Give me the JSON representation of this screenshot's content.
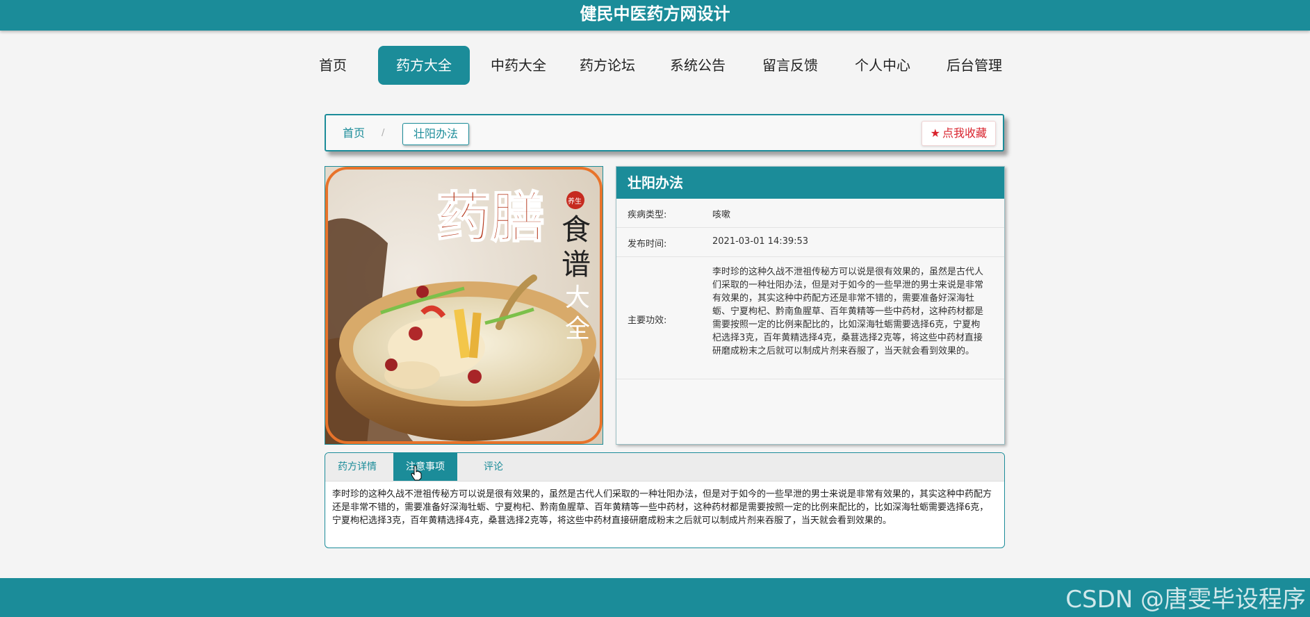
{
  "site": {
    "title": "健民中医药方网设计"
  },
  "nav": {
    "items": [
      "首页",
      "药方大全",
      "中药大全",
      "药方论坛",
      "系统公告",
      "留言反馈",
      "个人中心",
      "后台管理"
    ],
    "active": "药方大全"
  },
  "breadcrumb": {
    "home": "首页",
    "separator": "/",
    "current": "壮阳办法"
  },
  "favorite_button": {
    "icon": "star-icon",
    "label": "点我收藏"
  },
  "image": {
    "title_big": "药膳",
    "title_badge": "养生",
    "title_side": [
      "食",
      "谱",
      "大",
      "全"
    ]
  },
  "detail": {
    "title": "壮阳办法",
    "rows": [
      {
        "label": "疾病类型:",
        "value": "咳嗽"
      },
      {
        "label": "发布时间:",
        "value": "2021-03-01 14:39:53"
      },
      {
        "label": "主要功效:",
        "value": "李时珍的这种久战不泄祖传秘方可以说是很有效果的，虽然是古代人们采取的一种壮阳办法，但是对于如今的一些早泄的男士来说是非常有效果的，其实这种中药配方还是非常不错的，需要准备好深海牡蛎、宁夏枸杞、黔南鱼腥草、百年黄精等一些中药材，这种药材都是需要按照一定的比例来配比的，比如深海牡蛎需要选择6克，宁夏枸杞选择3克，百年黄精选择4克，桑葚选择2克等，将这些中药材直接研磨成粉末之后就可以制成片剂来吞服了，当天就会看到效果的。"
      }
    ]
  },
  "tabs": {
    "items": [
      "药方详情",
      "注意事项",
      "评论"
    ],
    "active": "注意事项",
    "content": "李时珍的这种久战不泄祖传秘方可以说是很有效果的，虽然是古代人们采取的一种壮阳办法，但是对于如今的一些早泄的男士来说是非常有效果的，其实这种中药配方还是非常不错的，需要准备好深海牡蛎、宁夏枸杞、黔南鱼腥草、百年黄精等一些中药材，这种药材都是需要按照一定的比例来配比的，比如深海牡蛎需要选择6克，宁夏枸杞选择3克，百年黄精选择4克，桑葚选择2克等，将这些中药材直接研磨成粉末之后就可以制成片剂来吞服了，当天就会看到效果的。"
  },
  "watermark": "CSDN @唐雯毕设程序",
  "colors": {
    "primary": "#1b8c99",
    "favorite": "#d9232d",
    "background": "#f4f4f4"
  }
}
